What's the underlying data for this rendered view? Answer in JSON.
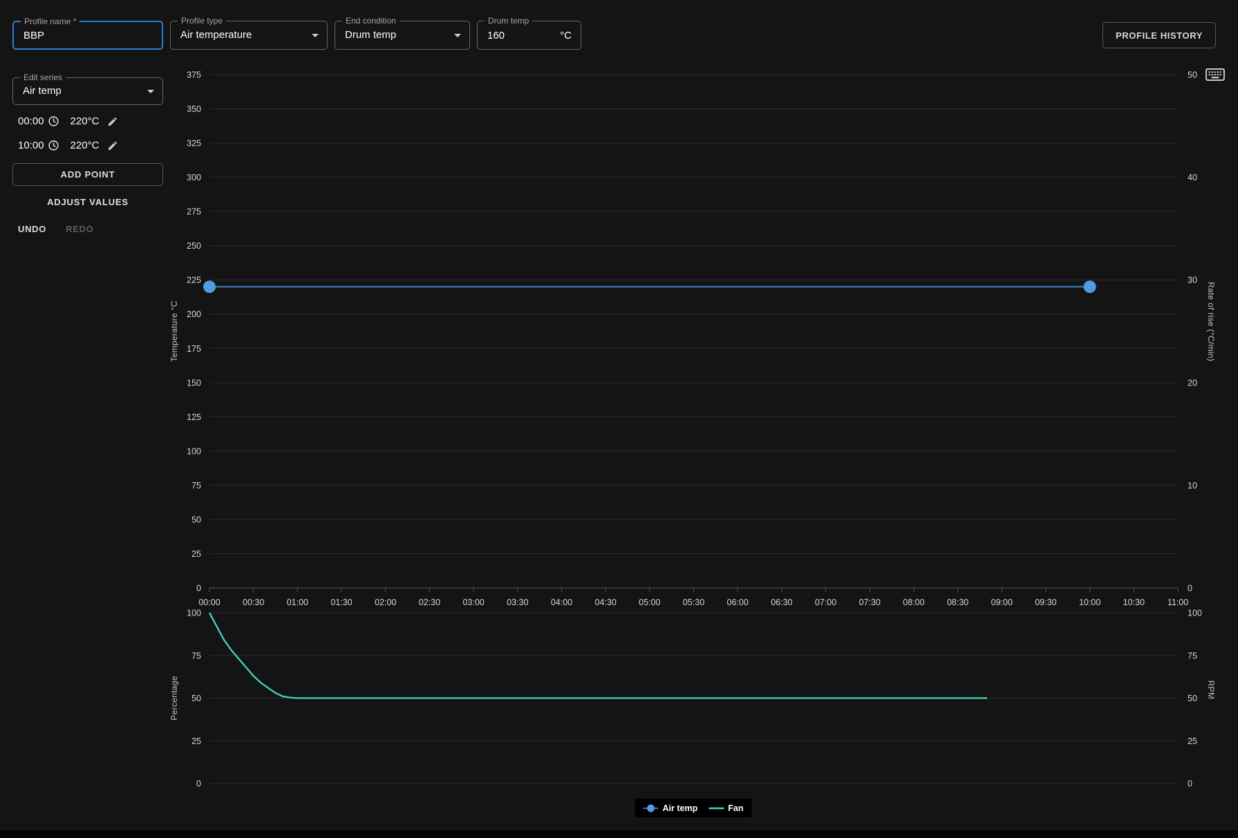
{
  "header": {
    "profile_name": {
      "label": "Profile name *",
      "value": "BBP"
    },
    "profile_type": {
      "label": "Profile type",
      "value": "Air temperature"
    },
    "end_condition": {
      "label": "End condition",
      "value": "Drum temp"
    },
    "drum_temp": {
      "label": "Drum temp",
      "value": "160",
      "unit": "°C"
    },
    "history_button_label": "PROFILE HISTORY"
  },
  "sidebar": {
    "edit_series": {
      "label": "Edit series",
      "value": "Air temp"
    },
    "points": [
      {
        "time": "00:00",
        "temp": "220°C"
      },
      {
        "time": "10:00",
        "temp": "220°C"
      }
    ],
    "add_point_label": "ADD POINT",
    "adjust_values_label": "ADJUST VALUES",
    "undo_label": "UNDO",
    "redo_label": "REDO"
  },
  "colors": {
    "accent_blue": "#2d7ed3",
    "air_temp_line": "#3a6ea5",
    "air_temp_marker": "#4f9be4",
    "fan_line": "#3fd6c7",
    "background": "#141414"
  },
  "chart_data": [
    {
      "type": "line",
      "ylabel_left": "Temperature °C",
      "ylabel_right": "Rate of rise (°C/min)",
      "y_left": {
        "min": 0,
        "max": 375
      },
      "y_left_ticks": [
        0,
        25,
        50,
        75,
        100,
        125,
        150,
        175,
        200,
        225,
        250,
        275,
        300,
        325,
        350,
        375
      ],
      "y_right": {
        "min": 0,
        "max": 50
      },
      "y_right_ticks": [
        0,
        10,
        20,
        30,
        40,
        50
      ],
      "x": {
        "min_minutes": 0,
        "max_minutes": 660,
        "tick_step_minutes": 30
      },
      "x_tick_labels": [
        "00:00",
        "00:30",
        "01:00",
        "01:30",
        "02:00",
        "02:30",
        "03:00",
        "03:30",
        "04:00",
        "04:30",
        "05:00",
        "05:30",
        "06:00",
        "06:30",
        "07:00",
        "07:30",
        "08:00",
        "08:30",
        "09:00",
        "09:30",
        "10:00",
        "10:30",
        "11:00"
      ],
      "grid": true,
      "legend_position": "bottom",
      "series": [
        {
          "name": "Air temp",
          "color": "#3a6ea5",
          "marker_color": "#4f9be4",
          "markers": true,
          "points": [
            [
              0,
              220
            ],
            [
              600,
              220
            ]
          ]
        }
      ]
    },
    {
      "type": "line",
      "ylabel_left": "Percentage",
      "ylabel_right": "RPM",
      "y_left": {
        "min": 0,
        "max": 100
      },
      "y_left_ticks": [
        0,
        25,
        50,
        75,
        100
      ],
      "y_right_ticks": [
        0,
        25,
        50,
        75,
        100
      ],
      "grid": true,
      "series": [
        {
          "name": "Fan",
          "color": "#3fd6c7",
          "markers": false,
          "points": [
            [
              0,
              100
            ],
            [
              5,
              92
            ],
            [
              10,
              84
            ],
            [
              15,
              78
            ],
            [
              20,
              73
            ],
            [
              25,
              68
            ],
            [
              30,
              63
            ],
            [
              35,
              59
            ],
            [
              40,
              56
            ],
            [
              45,
              53
            ],
            [
              50,
              51
            ],
            [
              55,
              50.3
            ],
            [
              60,
              50
            ],
            [
              530,
              50
            ]
          ]
        }
      ]
    }
  ],
  "legend": [
    {
      "label": "Air temp",
      "color": "#4f9be4",
      "marker": "point"
    },
    {
      "label": "Fan",
      "color": "#3fd6c7",
      "marker": "line"
    }
  ]
}
